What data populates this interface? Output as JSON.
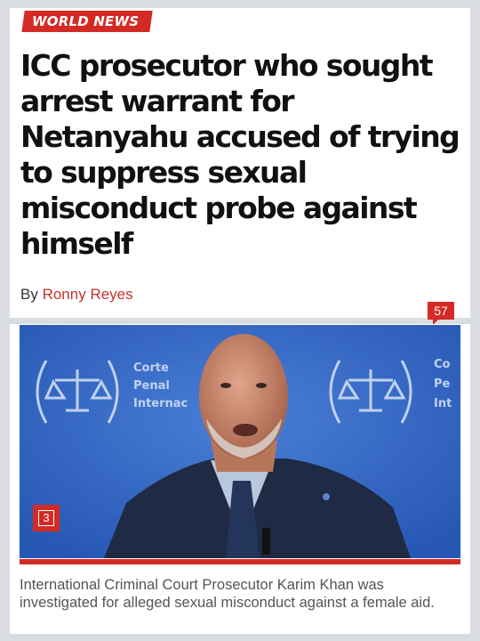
{
  "article": {
    "section": "WORLD NEWS",
    "headline": "ICC prosecutor who sought arrest warrant for Netanyahu accused of trying to suppress sexual misconduct probe against himself",
    "byline_prefix": "By",
    "author": "Ronny Reyes",
    "comment_count": "57"
  },
  "photo": {
    "backdrop_left_text": [
      "Corte",
      "Penal",
      "Internac"
    ],
    "backdrop_right_text": [
      "Co",
      "Pe",
      "Int"
    ],
    "gallery_count": "3"
  },
  "caption": "International Criminal Court Prosecutor Karim Khan was investigated for alleged sexual misconduct against a female aid.",
  "colors": {
    "brand_red": "#d42a25",
    "backdrop_blue": "#2e63c4"
  }
}
